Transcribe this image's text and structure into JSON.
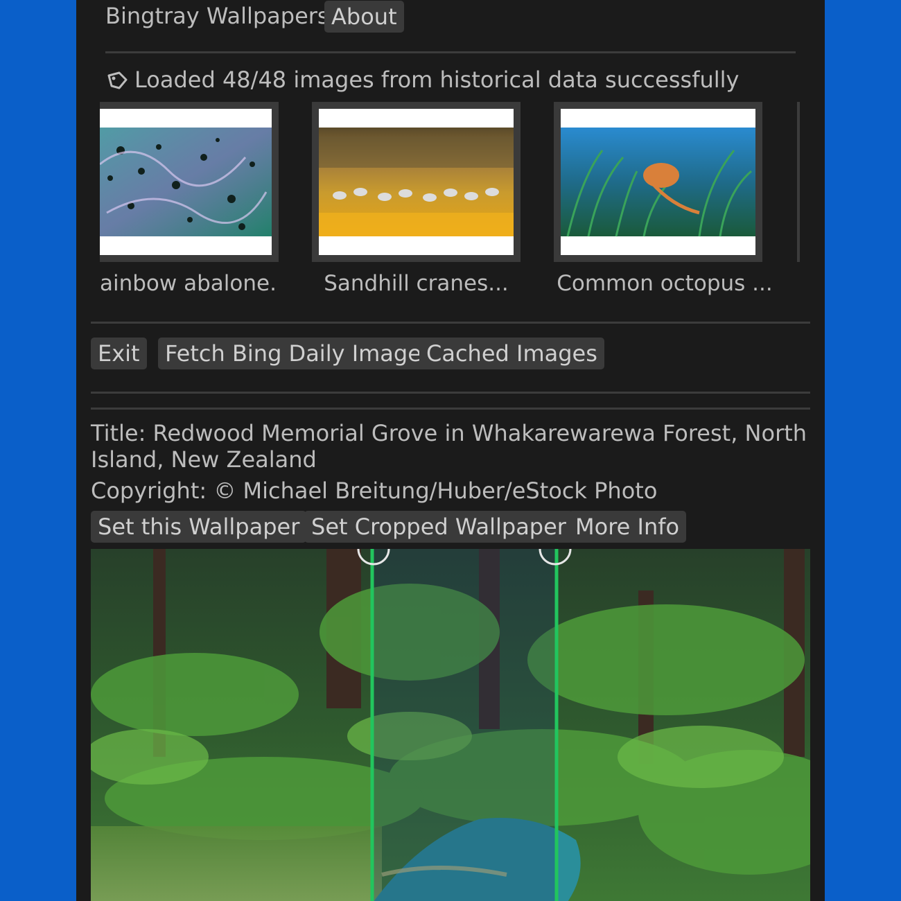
{
  "app": {
    "title": "Bingtray Wallpapers",
    "about_label": "About"
  },
  "status": {
    "icon": "tag-icon",
    "message": "Loaded 48/48 images from historical data successfully"
  },
  "gallery": {
    "items": [
      {
        "caption": "Rainbow abalone...",
        "visible_caption": "ainbow abalone..."
      },
      {
        "caption": "Sandhill cranes..."
      },
      {
        "caption": "Common octopus ..."
      }
    ]
  },
  "actions": {
    "exit": "Exit",
    "fetch": "Fetch Bing Daily Image",
    "cached": "Cached Images"
  },
  "details": {
    "title_line1": "Title: Redwood Memorial Grove in Whakarewarewa Forest, North",
    "title_line2": "Island, New Zealand",
    "copyright": "Copyright: © Michael Breitung/Huber/eStock Photo"
  },
  "wallpaper_actions": {
    "set": "Set this Wallpaper",
    "set_cropped": "Set Cropped Wallpaper",
    "more_info": "More Info"
  },
  "colors": {
    "crop_handle": "#22c55e",
    "background": "#0a5fc9",
    "panel": "#1b1b1b"
  }
}
